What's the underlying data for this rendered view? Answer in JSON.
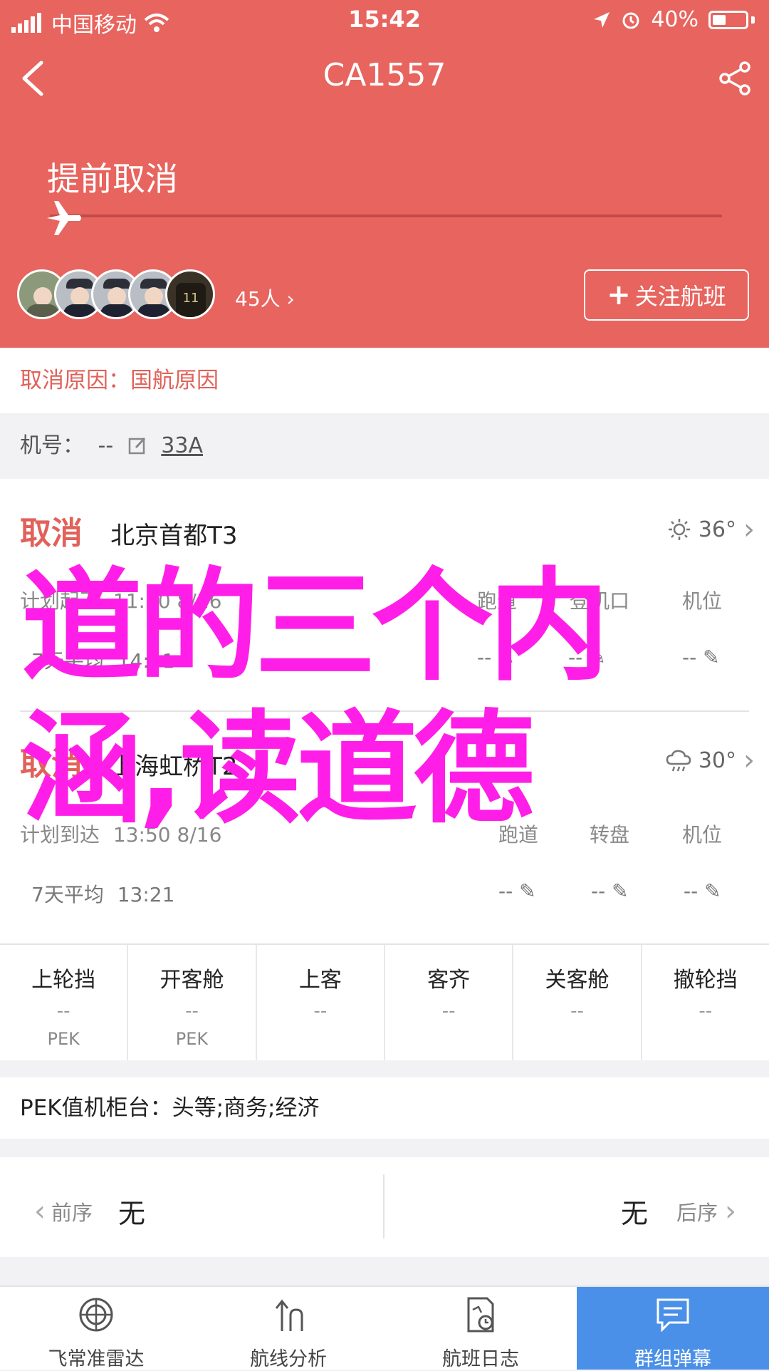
{
  "status_bar": {
    "carrier": "中国移动",
    "time": "15:42",
    "battery": "40%",
    "battery_level": 0.4
  },
  "nav": {
    "title": "CA1557"
  },
  "flight": {
    "status": "提前取消",
    "progress": 0,
    "followers_label": "45人",
    "follow_button": "关注航班"
  },
  "cancel_reason": {
    "label": "取消原因：",
    "value": "国航原因"
  },
  "aircraft": {
    "label": "机号：",
    "value": "--",
    "model": "33A"
  },
  "departure": {
    "status": "取消",
    "airport": "北京首都T3",
    "temp": "36°",
    "weather_icon": "sun-icon",
    "planned_label": "计划起飞",
    "planned_value": "11:30 8/16",
    "avg_label": "7天平均",
    "avg_value": "14:41",
    "col_labels": [
      "跑道",
      "登机口",
      "机位"
    ],
    "col_values": [
      "--",
      "--",
      "--"
    ]
  },
  "arrival": {
    "status": "取消",
    "airport": "上海虹桥T2",
    "temp": "30°",
    "weather_icon": "cloud-rain-icon",
    "planned_label": "计划到达",
    "planned_value": "13:50 8/16",
    "avg_label": "7天平均",
    "avg_value": "13:21",
    "col_labels": [
      "跑道",
      "转盘",
      "机位"
    ],
    "col_values": [
      "--",
      "--",
      "--"
    ]
  },
  "overlay": {
    "line1": "道的三个内",
    "line2": "涵,读道德"
  },
  "stages": [
    {
      "title": "上轮挡",
      "value": "--",
      "airport": "PEK"
    },
    {
      "title": "开客舱",
      "value": "--",
      "airport": "PEK"
    },
    {
      "title": "上客",
      "value": "--",
      "airport": ""
    },
    {
      "title": "客齐",
      "value": "--",
      "airport": ""
    },
    {
      "title": "关客舱",
      "value": "--",
      "airport": ""
    },
    {
      "title": "撤轮挡",
      "value": "--",
      "airport": ""
    }
  ],
  "checkin": {
    "label": "PEK值机柜台：",
    "value": "头等;商务;经济"
  },
  "sequence": {
    "prev_label": "前序",
    "prev_value": "无",
    "next_label": "后序",
    "next_value": "无"
  },
  "tabbar": [
    {
      "label": "飞常准雷达",
      "icon": "radar-icon"
    },
    {
      "label": "航线分析",
      "icon": "route-icon"
    },
    {
      "label": "航班日志",
      "icon": "log-icon"
    },
    {
      "label": "群组弹幕",
      "icon": "chat-icon"
    }
  ],
  "colors": {
    "header": "#e8645e",
    "cancel_red": "#e0625a",
    "overlay_magenta": "#ff1ee8",
    "tab_active": "#4b90e8"
  }
}
